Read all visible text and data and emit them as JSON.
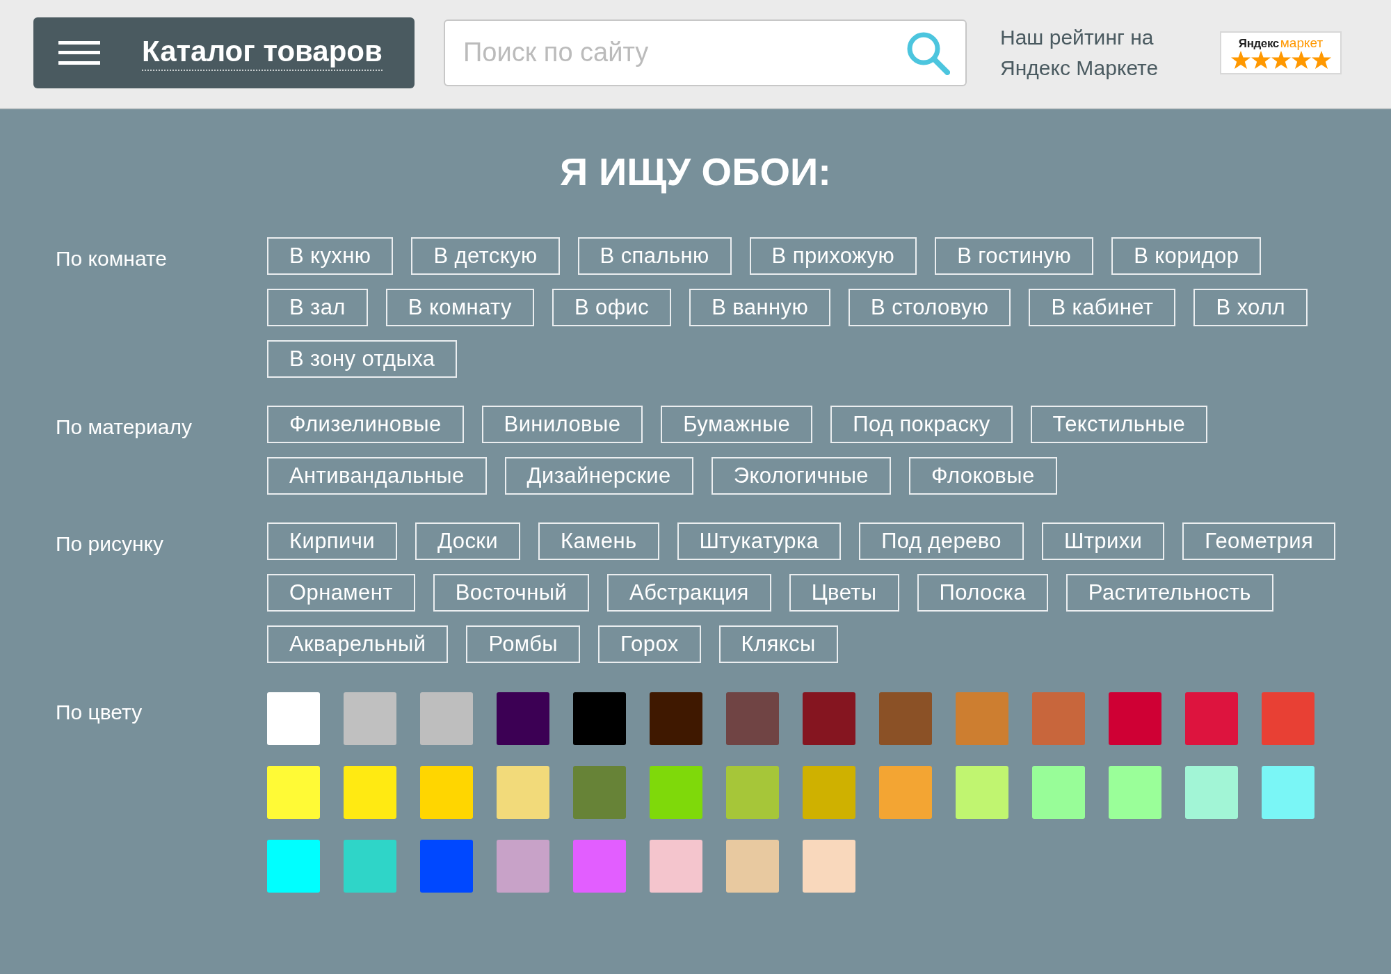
{
  "header": {
    "catalog_button": "Каталог товаров",
    "search": {
      "placeholder": "Поиск по сайту"
    },
    "rating_text": "Наш рейтинг на Яндекс Маркете",
    "rating_badge": {
      "brand": "Яндекс",
      "product": "маркет",
      "stars": 5
    }
  },
  "title": "Я ИЩУ ОБОИ:",
  "filters": [
    {
      "kind": "tags",
      "label": "По комнате",
      "items": [
        "В кухню",
        "В детскую",
        "В спальню",
        "В прихожую",
        "В гостиную",
        "В коридор",
        "В зал",
        "В комнату",
        "В офис",
        "В ванную",
        "В столовую",
        "В кабинет",
        "В холл",
        "В зону отдыха"
      ]
    },
    {
      "kind": "tags",
      "label": "По материалу",
      "items": [
        "Флизелиновые",
        "Виниловые",
        "Бумажные",
        "Под покраску",
        "Текстильные",
        "Антивандальные",
        "Дизайнерские",
        "Экологичные",
        "Флоковые"
      ]
    },
    {
      "kind": "tags",
      "label": "По рисунку",
      "items": [
        "Кирпичи",
        "Доски",
        "Камень",
        "Штукатурка",
        "Под дерево",
        "Штрихи",
        "Геометрия",
        "Орнамент",
        "Восточный",
        "Абстракция",
        "Цветы",
        "Полоска",
        "Растительность",
        "Акварельный",
        "Ромбы",
        "Горох",
        "Кляксы"
      ]
    },
    {
      "kind": "colors",
      "label": "По цвету",
      "swatches": [
        {
          "color": "#ffffff"
        },
        {
          "color": "#c0c0c0"
        },
        {
          "color": "#bebebe"
        },
        {
          "color": "#3c0054"
        },
        {
          "color": "#000000"
        },
        {
          "color": "#3f1800"
        },
        {
          "color": "#704444"
        },
        {
          "color": "#851520"
        },
        {
          "color": "#8b5126"
        },
        {
          "color": "#cd7e30"
        },
        {
          "color": "#c8663c"
        },
        {
          "color": "#cf0034"
        },
        {
          "color": "#dd143e"
        },
        {
          "color": "#e84034"
        },
        {
          "color": "#fffa36"
        },
        {
          "color": "#ffea12"
        },
        {
          "color": "#ffd600"
        },
        {
          "color": "#f2da7a"
        },
        {
          "color": "#678337"
        },
        {
          "color": "#7fd90a"
        },
        {
          "color": "#a6c639"
        },
        {
          "color": "#cfb100"
        },
        {
          "color": "#f3a533"
        },
        {
          "color": "#c0f570"
        },
        {
          "color": "#98fd98"
        },
        {
          "color": "#9aff99"
        },
        {
          "color": "#a2f5d6"
        },
        {
          "color": "#7af6f6"
        },
        {
          "color": "#00ffff"
        },
        {
          "color": "#2fd5c8"
        },
        {
          "color": "#0048ff"
        },
        {
          "color": "#c8a2c8"
        },
        {
          "color": "#e25eff"
        },
        {
          "color": "#f4c5cd"
        },
        {
          "color": "#e8c9a0"
        },
        {
          "color": "#f9d8bc"
        }
      ]
    }
  ]
}
